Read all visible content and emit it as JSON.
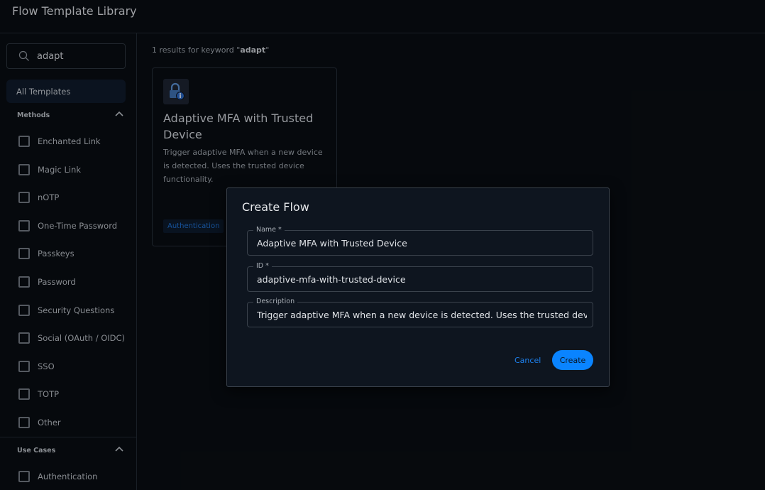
{
  "header": {
    "title": "Flow Template Library"
  },
  "sidebar": {
    "search": {
      "value": "adapt",
      "icon": "search-icon"
    },
    "all_templates": "All Templates",
    "methods": {
      "label": "Methods",
      "items": [
        "Enchanted Link",
        "Magic Link",
        "nOTP",
        "One-Time Password",
        "Passkeys",
        "Password",
        "Security Questions",
        "Social (OAuth / OIDC)",
        "SSO",
        "TOTP",
        "Other"
      ]
    },
    "use_cases": {
      "label": "Use Cases",
      "items": [
        "Authentication"
      ]
    }
  },
  "main": {
    "results_prefix": "1 results for keyword \"",
    "keyword": "adapt",
    "results_suffix": "\"",
    "card": {
      "title": "Adaptive MFA with Trusted Device",
      "description": "Trigger adaptive MFA when a new device is detected. Uses the trusted device functionality.",
      "tag": "Authentication",
      "icon": "lock-info-icon"
    }
  },
  "dialog": {
    "title": "Create Flow",
    "name_label": "Name *",
    "name_value": "Adaptive MFA with Trusted Device",
    "id_label": "ID *",
    "id_value": "adaptive-mfa-with-trusted-device",
    "desc_label": "Description",
    "desc_value": "Trigger adaptive MFA when a new device is detected. Uses the trusted device functionality.",
    "cancel": "Cancel",
    "create": "Create"
  },
  "colors": {
    "accent": "#0a84ff",
    "background": "#090d12",
    "dialog": "#0e151f"
  }
}
